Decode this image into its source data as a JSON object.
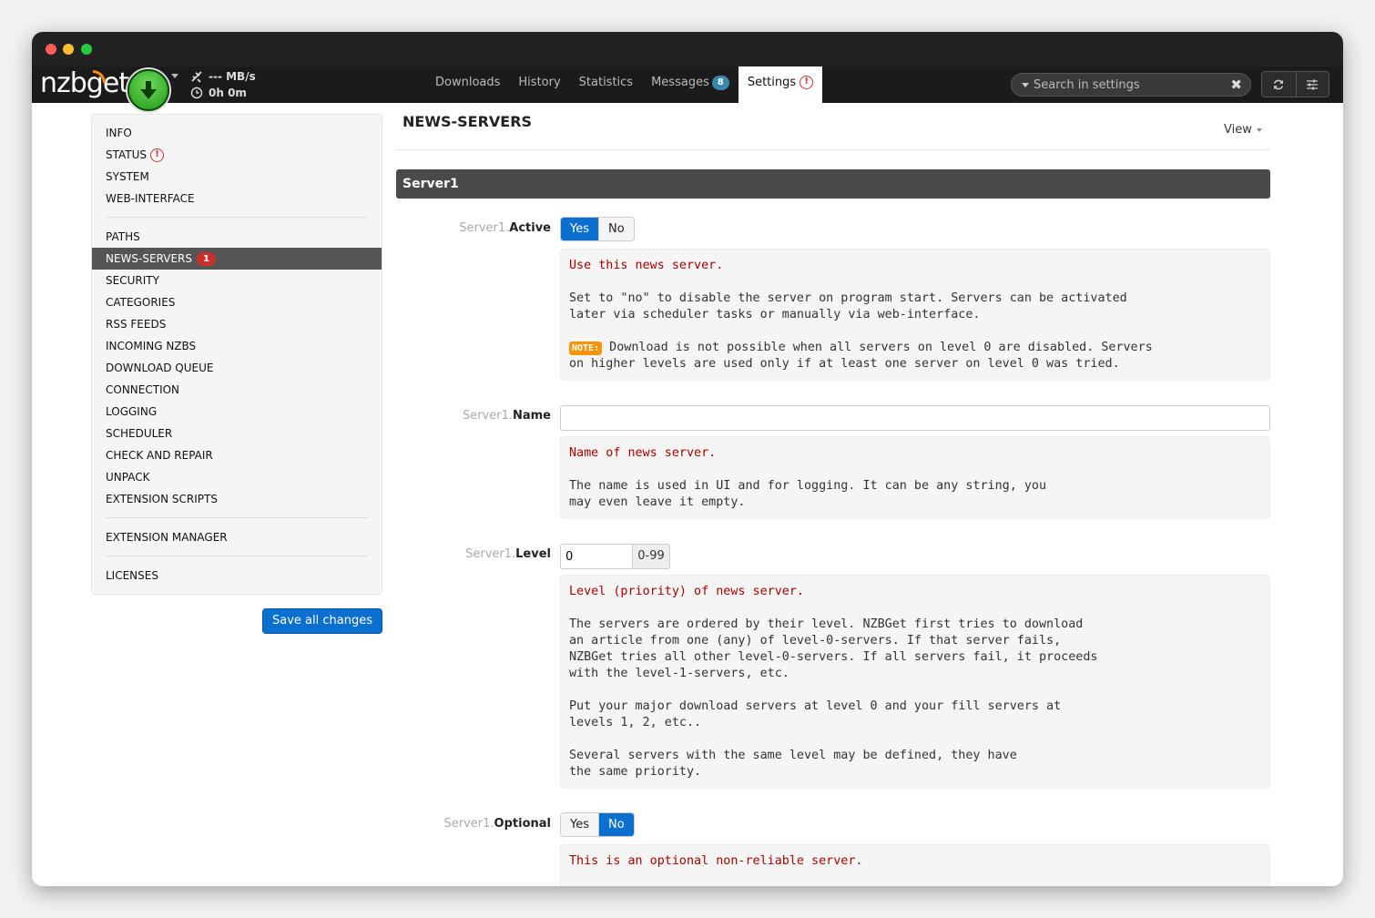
{
  "navbar": {
    "logo": "nzbget",
    "speed": "--- MB/s",
    "time": "0h 0m",
    "links": [
      {
        "label": "Downloads"
      },
      {
        "label": "History"
      },
      {
        "label": "Statistics"
      },
      {
        "label": "Messages",
        "badge": "8"
      },
      {
        "label": "Settings",
        "alert": "!"
      }
    ],
    "search_placeholder": "Search in settings"
  },
  "sidebar": {
    "group1": [
      "INFO",
      "STATUS",
      "SYSTEM",
      "WEB-INTERFACE"
    ],
    "status_alert": "!",
    "group2": [
      "PATHS",
      "NEWS-SERVERS",
      "SECURITY",
      "CATEGORIES",
      "RSS FEEDS",
      "INCOMING NZBS",
      "DOWNLOAD QUEUE",
      "CONNECTION",
      "LOGGING",
      "SCHEDULER",
      "CHECK AND REPAIR",
      "UNPACK",
      "EXTENSION SCRIPTS"
    ],
    "news_servers_badge": "1",
    "group3": [
      "EXTENSION MANAGER"
    ],
    "group4": [
      "LICENSES"
    ],
    "save_label": "Save all changes"
  },
  "main": {
    "title": "NEWS-SERVERS",
    "view_label": "View",
    "section_title": "Server1",
    "fields": {
      "active": {
        "prefix": "Server1.",
        "name": "Active",
        "yes": "Yes",
        "no": "No",
        "selected": "Yes",
        "help_first": "Use this news server.",
        "help_rest": "Set to \"no\" to disable the server on program start. Servers can be activated\nlater via scheduler tasks or manually via web-interface.",
        "note_tag": "NOTE:",
        "note_text": " Download is not possible when all servers on level 0 are disabled. Servers\non higher levels are used only if at least one server on level 0 was tried."
      },
      "name": {
        "prefix": "Server1.",
        "name": "Name",
        "value": "",
        "help_first": "Name of news server.",
        "help_rest": "The name is used in UI and for logging. It can be any string, you\nmay even leave it empty."
      },
      "level": {
        "prefix": "Server1.",
        "name": "Level",
        "value": "0",
        "range": "0-99",
        "help_first": "Level (priority) of news server.",
        "help_rest": "The servers are ordered by their level. NZBGet first tries to download\nan article from one (any) of level-0-servers. If that server fails,\nNZBGet tries all other level-0-servers. If all servers fail, it proceeds\nwith the level-1-servers, etc.\n\nPut your major download servers at level 0 and your fill servers at\nlevels 1, 2, etc..\n\nSeveral servers with the same level may be defined, they have\nthe same priority."
      },
      "optional": {
        "prefix": "Server1.",
        "name": "Optional",
        "yes": "Yes",
        "no": "No",
        "selected": "No",
        "help_first": "This is an optional non-reliable server."
      }
    }
  },
  "colors": {
    "accent": "#0a6fcf",
    "play": "#2fae24",
    "alert": "#c9302c",
    "help_first_line": "#aa0000",
    "note": "#f89406"
  }
}
